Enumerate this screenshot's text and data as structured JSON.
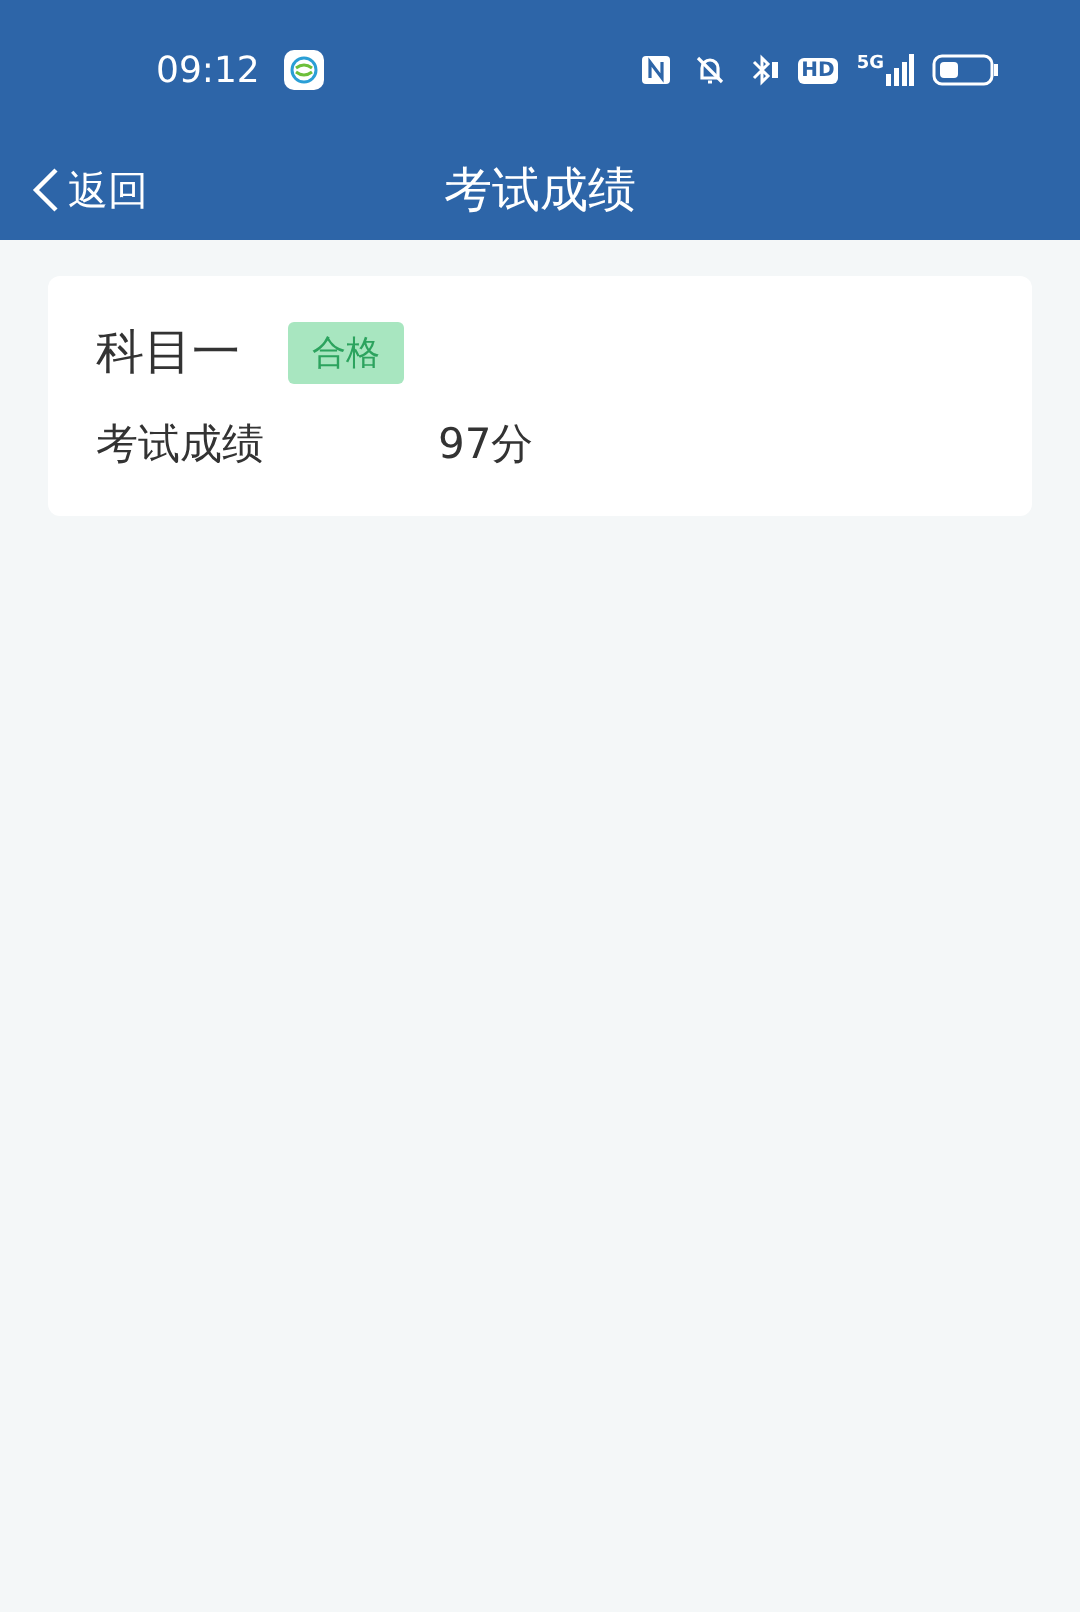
{
  "status_bar": {
    "time": "09:12",
    "hd": "HD",
    "network": "5G"
  },
  "nav": {
    "back": "返回",
    "title": "考试成绩"
  },
  "results": [
    {
      "subject": "科目一",
      "badge": "合格",
      "label": "考试成绩",
      "score": "97分"
    }
  ]
}
